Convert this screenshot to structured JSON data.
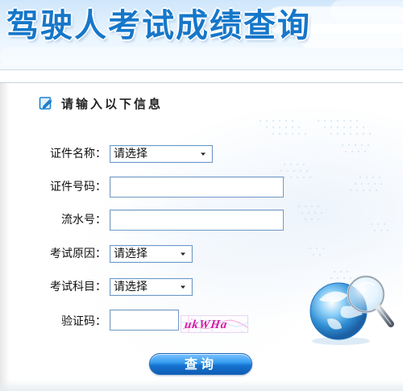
{
  "page": {
    "title": "驾驶人考试成绩查询"
  },
  "section": {
    "heading": "请输入以下信息"
  },
  "form": {
    "id_type": {
      "label": "证件名称：",
      "value": "请选择"
    },
    "id_number": {
      "label": "证件号码：",
      "value": ""
    },
    "serial_number": {
      "label": "流水号：",
      "value": ""
    },
    "exam_reason": {
      "label": "考试原因：",
      "value": "请选择"
    },
    "exam_subject": {
      "label": "考试科目：",
      "value": "请选择"
    },
    "verification_code": {
      "label": "验证码：",
      "value": "",
      "captcha_text": "ukWHa"
    }
  },
  "actions": {
    "query_label": "查询"
  },
  "icons": {
    "heading": "edit-icon",
    "dropdown": "chevron-down-icon",
    "globe": "globe-search-icon"
  },
  "colors": {
    "title_blue": "#1677c9",
    "border_blue": "#6f99c7",
    "button_blue": "#1572cf",
    "captcha_magenta": "#d51aa7"
  }
}
